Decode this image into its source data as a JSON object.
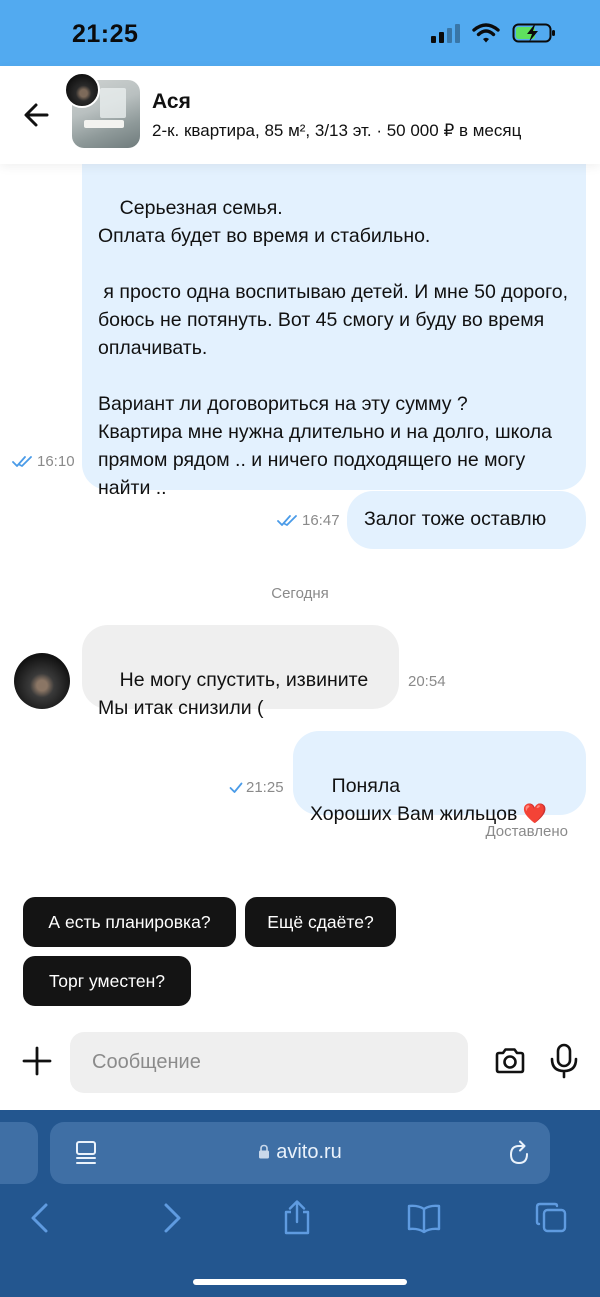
{
  "status_bar": {
    "time": "21:25"
  },
  "header": {
    "contact_name": "Ася",
    "listing_info": "2-к. квартира, 85 м², 3/13 эт. · 50 000 ₽ в месяц"
  },
  "messages": [
    {
      "direction": "out",
      "text": "Серьезная семья.\nОплата будет во время и стабильно.\n\n я просто одна воспитываю детей. И мне 50 дорого, боюсь не потянуть. Вот 45 смогу и буду во время оплачивать.\n\nВариант ли договориться на эту сумму ?\nКвартира мне нужна длительно и на долго, школа прямом рядом .. и ничего подходящего не могу найти ..",
      "time": "16:10",
      "status": "read"
    },
    {
      "direction": "out",
      "text": "Залог тоже оставлю",
      "time": "16:47",
      "status": "read"
    },
    {
      "direction": "in",
      "text": "Не могу спустить, извините\nМы итак снизили (",
      "time": "20:54"
    },
    {
      "direction": "out",
      "text": "Поняла\nХороших Вам жильцов ❤️",
      "time": "21:25",
      "status": "sent"
    }
  ],
  "date_separator": "Сегодня",
  "delivered_label": "Доставлено",
  "quick_replies": [
    "А есть планировка?",
    "Ещё сдаёте?",
    "Торг уместен?"
  ],
  "input": {
    "placeholder": "Сообщение",
    "value": ""
  },
  "browser": {
    "url": "avito.ru"
  },
  "colors": {
    "status_bar_bg": "#52aaf0",
    "outgoing_bubble": "#e3f1fe",
    "incoming_bubble": "#efefef",
    "check_mark": "#4a9be8",
    "chip_bg": "#141414",
    "browser_bg": "#23568f",
    "url_bar_bg": "#3f6fa5",
    "heart": "#e0242b"
  },
  "icons": [
    "back-arrow-icon",
    "double-check-icon",
    "single-check-icon",
    "plus-icon",
    "camera-icon",
    "microphone-icon",
    "lock-icon",
    "tabs-list-icon",
    "reload-icon",
    "back-icon",
    "forward-icon",
    "share-icon",
    "bookmarks-icon",
    "tabs-icon",
    "wifi-icon",
    "battery-charging-icon",
    "cellular-signal-icon"
  ]
}
